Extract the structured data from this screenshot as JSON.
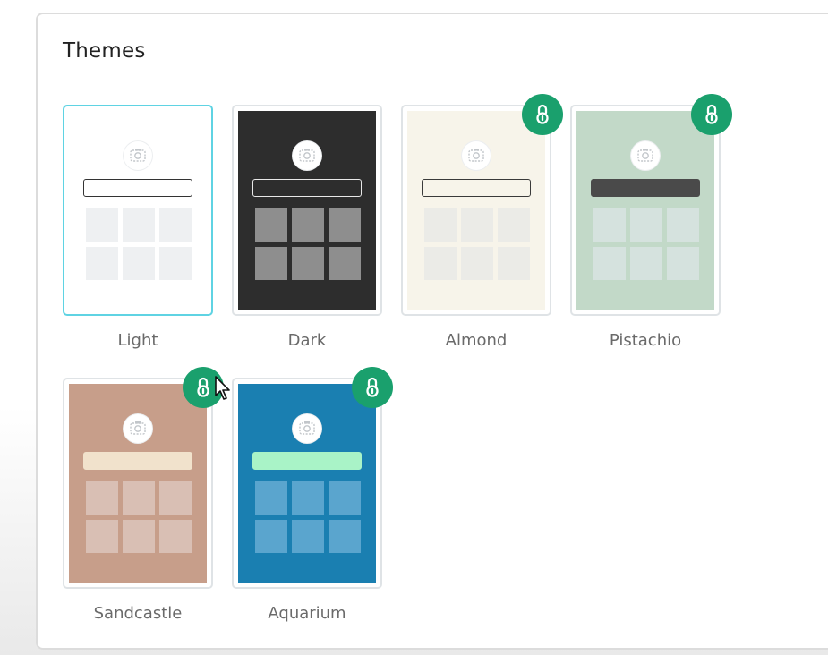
{
  "section": {
    "title": "Themes"
  },
  "themes": [
    {
      "name": "Light",
      "locked": false,
      "selected": true,
      "colors": {
        "bg": "#ffffff",
        "bar_fill": "#ffffff",
        "bar_border": "#333333",
        "cell": "#eef0f2"
      }
    },
    {
      "name": "Dark",
      "locked": false,
      "selected": false,
      "colors": {
        "bg": "#2d2d2d",
        "bar_fill": "#2d2d2d",
        "bar_border": "#e8e8e8",
        "cell": "#8e8e8e"
      }
    },
    {
      "name": "Almond",
      "locked": true,
      "selected": false,
      "colors": {
        "bg": "#f7f4ea",
        "bar_fill": "#f7f4ea",
        "bar_border": "#3a3a3a",
        "cell": "#ebebe7"
      }
    },
    {
      "name": "Pistachio",
      "locked": true,
      "selected": false,
      "colors": {
        "bg": "#c2d9c8",
        "bar_fill": "#4a4a4a",
        "bar_border": "#4a4a4a",
        "cell": "#d5e2de"
      }
    },
    {
      "name": "Sandcastle",
      "locked": true,
      "selected": false,
      "colors": {
        "bg": "#c79e8a",
        "bar_fill": "#f1e2cc",
        "bar_border": "#f1e2cc",
        "cell": "#d9bfb4"
      }
    },
    {
      "name": "Aquarium",
      "locked": true,
      "selected": false,
      "colors": {
        "bg": "#1a7fb1",
        "bar_fill": "#a9f3c7",
        "bar_border": "#a9f3c7",
        "cell": "#5aa5ce"
      }
    }
  ],
  "icons": {
    "lock": "lock-icon",
    "logo": "camera-logo-icon",
    "cursor": "mouse-pointer-icon"
  },
  "accent": {
    "lock_badge": "#1aa06d",
    "selected_border": "#5fd3e3"
  }
}
